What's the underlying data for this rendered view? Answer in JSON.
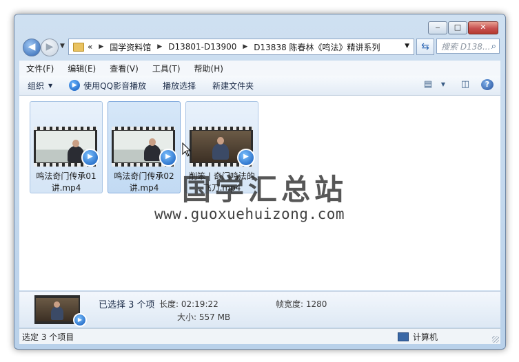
{
  "window": {
    "caption_buttons": {
      "minimize": "‒",
      "maximize": "□",
      "close": "✕"
    }
  },
  "navigation": {
    "back_icon": "arrow-left-icon",
    "forward_icon": "arrow-right-icon",
    "breadcrumb_overflow": "«",
    "breadcrumbs": [
      "国学资料馆",
      "D13801-D13900",
      "D13838 陈春林《鸣法》精讲系列"
    ],
    "search_placeholder": "搜索 D138..."
  },
  "menu": {
    "items": [
      "文件(F)",
      "编辑(E)",
      "查看(V)",
      "工具(T)",
      "帮助(H)"
    ]
  },
  "toolbar": {
    "organize": "组织",
    "play_with_qq": "使用QQ影音播放",
    "play_selection": "播放选择",
    "new_folder": "新建文件夹"
  },
  "files": [
    {
      "name": "鸣法奇门传承01讲.mp4",
      "selected": true
    },
    {
      "name": "鸣法奇门传承02讲.mp4",
      "selected": true
    },
    {
      "name": "削笨 | 奇门鸣法的飞刀.mp4",
      "selected": true
    }
  ],
  "watermark": {
    "text_cn": "国学汇总站",
    "url": "www.guoxuehuizong.com"
  },
  "details": {
    "selected_count": "已选择 3 个项",
    "duration": "长度: 02:19:22",
    "size": "大小: 557 MB",
    "frame_width": "帧宽度: 1280"
  },
  "status": {
    "left": "选定 3 个项目",
    "right": "计算机"
  }
}
